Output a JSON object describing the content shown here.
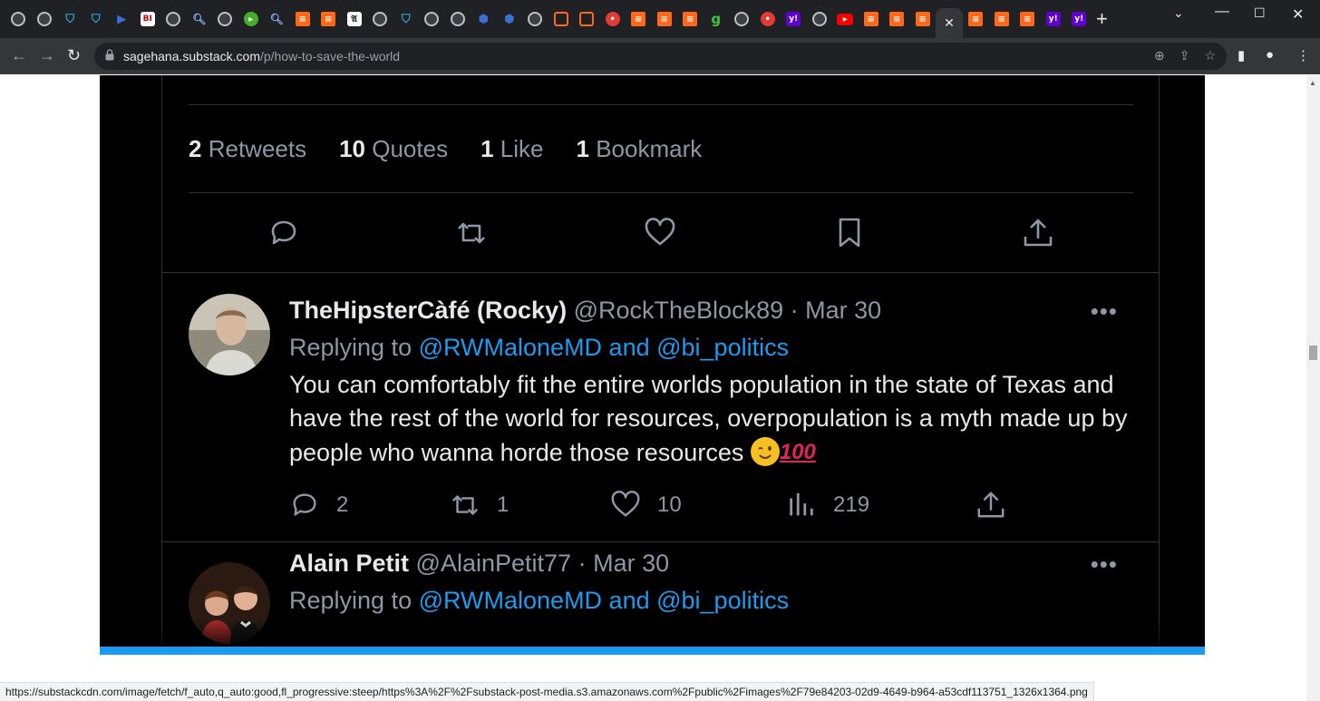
{
  "browser": {
    "tabs": [
      {
        "icon": "globe-icon"
      },
      {
        "icon": "globe-icon"
      },
      {
        "icon": "shield-icon"
      },
      {
        "icon": "shield-icon"
      },
      {
        "icon": "arrow-icon"
      },
      {
        "icon": "bi-icon",
        "text": "BI"
      },
      {
        "icon": "globe-icon"
      },
      {
        "icon": "search-icon"
      },
      {
        "icon": "globe-icon"
      },
      {
        "icon": "play-icon"
      },
      {
        "icon": "search-icon"
      },
      {
        "icon": "substack-icon"
      },
      {
        "icon": "substack-icon"
      },
      {
        "icon": "nyt-icon",
        "text": "𝔄"
      },
      {
        "icon": "globe-icon"
      },
      {
        "icon": "shield-icon"
      },
      {
        "icon": "globe-icon"
      },
      {
        "icon": "globe-icon"
      },
      {
        "icon": "blocks-icon"
      },
      {
        "icon": "blocks-icon"
      },
      {
        "icon": "globe-icon"
      },
      {
        "icon": "ublock-icon"
      },
      {
        "icon": "ublock-icon"
      },
      {
        "icon": "red-pin-icon"
      },
      {
        "icon": "substack-icon"
      },
      {
        "icon": "substack-icon"
      },
      {
        "icon": "substack-icon"
      },
      {
        "icon": "g-icon",
        "text": "g"
      },
      {
        "icon": "globe-icon"
      },
      {
        "icon": "red-pin-icon"
      },
      {
        "icon": "yahoo-icon",
        "text": "y!"
      },
      {
        "icon": "globe-icon"
      },
      {
        "icon": "youtube-icon"
      },
      {
        "icon": "substack-icon"
      },
      {
        "icon": "substack-icon"
      },
      {
        "icon": "substack-icon"
      },
      {
        "icon": "close-icon",
        "active": true
      },
      {
        "icon": "substack-icon"
      },
      {
        "icon": "substack-icon"
      },
      {
        "icon": "substack-icon"
      },
      {
        "icon": "yahoo-icon",
        "text": "y!"
      },
      {
        "icon": "yahoo-icon",
        "text": "y!"
      }
    ],
    "url_host": "sagehana.substack.com",
    "url_path": "/p/how-to-save-the-world",
    "status_url": "https://substackcdn.com/image/fetch/f_auto,q_auto:good,fl_progressive:steep/https%3A%2F%2Fsubstack-post-media.s3.amazonaws.com%2Fpublic%2Fimages%2F79e84203-02d9-4649-b964-a53cdf113751_1326x1364.png"
  },
  "embed": {
    "stats": [
      {
        "count": "2",
        "label": "Retweets"
      },
      {
        "count": "10",
        "label": "Quotes"
      },
      {
        "count": "1",
        "label": "Like"
      },
      {
        "count": "1",
        "label": "Bookmark"
      }
    ],
    "replies": [
      {
        "name": "TheHipsterCàfé (Rocky)",
        "handle": "@RockTheBlock89",
        "date": "Mar 30",
        "replying_label": "Replying to",
        "mentions": "@RWMaloneMD and @bi_politics",
        "text": "You can comfortably fit the entire worlds population in the state of Texas and have the rest of the world for resources, overpopulation is a myth made up by people who wanna horde those resources",
        "emoji_100": "100",
        "replies": "2",
        "retweets": "1",
        "likes": "10",
        "views": "219"
      },
      {
        "name": "Alain Petit",
        "handle": "@AlainPetit77",
        "date": "Mar 30",
        "replying_label": "Replying to",
        "mentions": "@RWMaloneMD and @bi_politics"
      }
    ]
  }
}
